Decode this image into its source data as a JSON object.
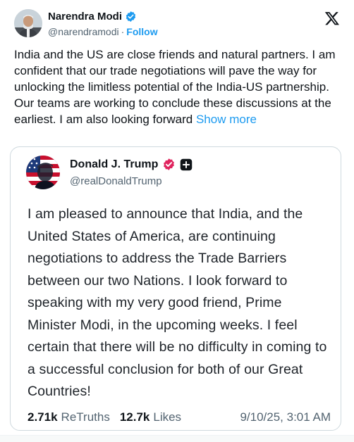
{
  "tweet": {
    "author_name": "Narendra Modi",
    "author_handle": "@narendramodi",
    "separator": "·",
    "follow_label": "Follow",
    "text": "India and the US are close friends and natural partners. I am confident that our trade negotiations will pave the way for unlocking the limitless potential of the India-US partnership. Our teams are working to conclude these discussions at the earliest. I am also looking forward ",
    "show_more_label": "Show more",
    "icons": {
      "verified": "verified-badge-icon",
      "platform": "x-logo-icon"
    },
    "colors": {
      "link": "#1d9bf0",
      "text": "#0f1419",
      "muted": "#536471"
    }
  },
  "quote": {
    "author_name": "Donald J. Trump",
    "author_handle": "@realDonaldTrump",
    "text": "I am pleased to announce that India, and the United States of America, are continuing negotiations to address the Trade Barriers between our two Nations. I look forward to speaking with my very good friend, Prime Minister Modi, in the upcoming weeks. I feel certain that there will be no difficulty in coming to a successful conclusion for both of our Great Countries!",
    "retruths_count": "2.71k",
    "retruths_label": "ReTruths",
    "likes_count": "12.7k",
    "likes_label": "Likes",
    "date": "9/10/25, 3:01 AM",
    "icons": {
      "verified": "red-verified-badge-icon",
      "extra": "plus-badge-icon"
    },
    "colors": {
      "badge": "#e0245e"
    }
  }
}
